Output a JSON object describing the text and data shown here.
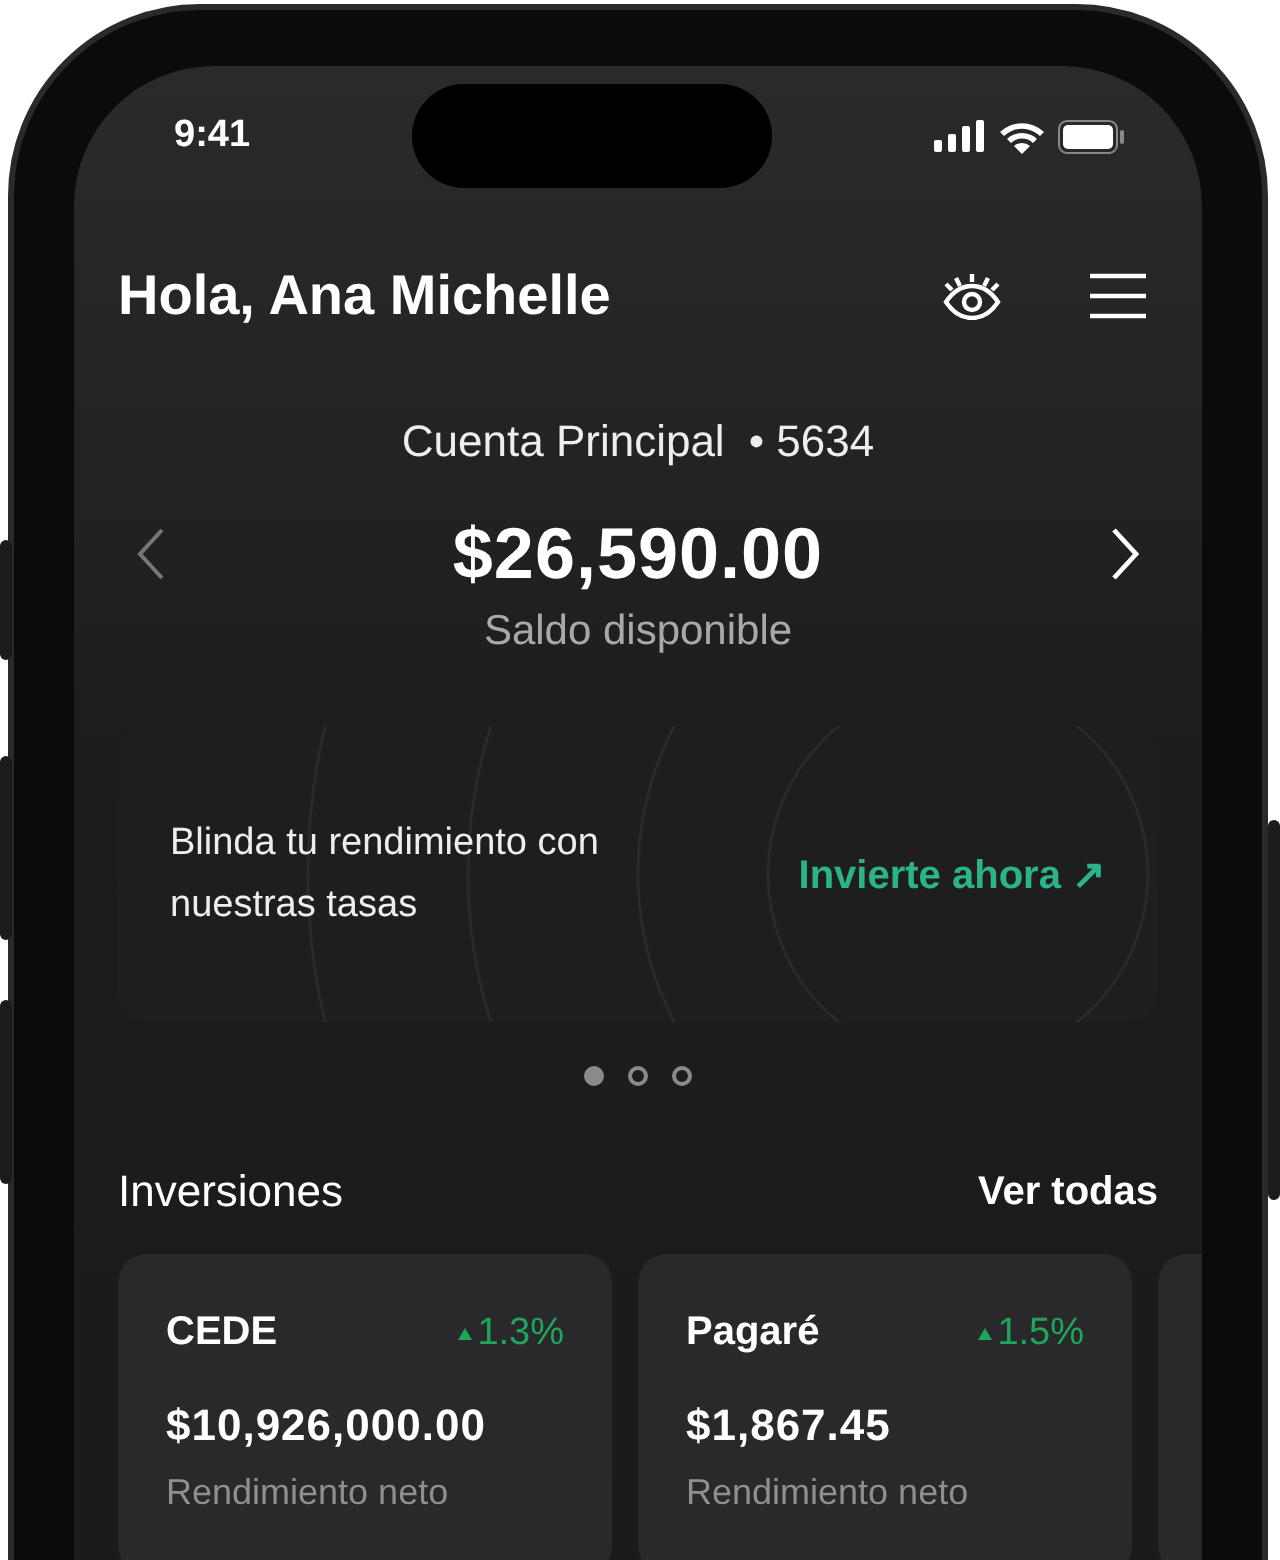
{
  "status_bar": {
    "time": "9:41"
  },
  "greeting": "Hola, Ana Michelle",
  "account": {
    "name": "Cuenta Principal",
    "number": "• 5634"
  },
  "balance": {
    "amount": "$26,590.00",
    "caption": "Saldo disponible"
  },
  "promo": {
    "text": "Blinda tu rendimiento con nuestras tasas",
    "action": "Invierte ahora ↗"
  },
  "carousel_dots": [
    {
      "selected": true
    },
    {
      "selected": false
    },
    {
      "selected": false
    }
  ],
  "investments": {
    "title": "Inversiones",
    "link": "Ver todas",
    "cards": [
      {
        "name": "CEDE",
        "change": "1.3%",
        "amount": "$10,926,000.00",
        "caption": "Rendimiento neto"
      },
      {
        "name": "Pagaré",
        "change": "1.5%",
        "amount": "$1,867.45",
        "caption": "Rendimiento neto"
      }
    ]
  }
}
